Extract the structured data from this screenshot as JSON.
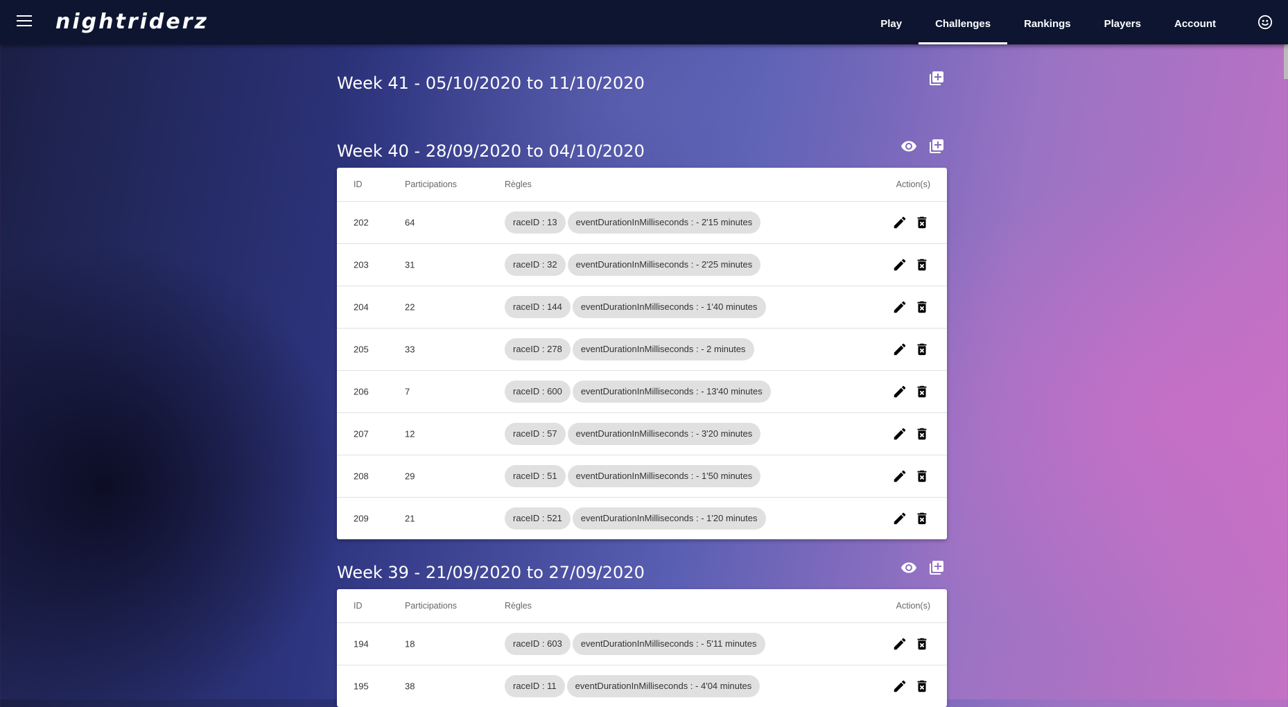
{
  "app": {
    "logo": "nightriderz"
  },
  "nav": {
    "items": [
      "Play",
      "Challenges",
      "Rankings",
      "Players",
      "Account"
    ],
    "active": "Challenges"
  },
  "columns": {
    "id": "ID",
    "participations": "Participations",
    "rules": "Règles",
    "actions": "Action(s)"
  },
  "weeks": [
    {
      "title": "Week 41 - 05/10/2020 to 11/10/2020",
      "has_view_icon": false,
      "rows": []
    },
    {
      "title": "Week 40 - 28/09/2020 to 04/10/2020",
      "has_view_icon": true,
      "rows": [
        {
          "id": "202",
          "participations": "64",
          "race": "raceID : 13",
          "duration": "eventDurationInMilliseconds : - 2'15 minutes"
        },
        {
          "id": "203",
          "participations": "31",
          "race": "raceID : 32",
          "duration": "eventDurationInMilliseconds : - 2'25 minutes"
        },
        {
          "id": "204",
          "participations": "22",
          "race": "raceID : 144",
          "duration": "eventDurationInMilliseconds : - 1'40 minutes"
        },
        {
          "id": "205",
          "participations": "33",
          "race": "raceID : 278",
          "duration": "eventDurationInMilliseconds : - 2 minutes"
        },
        {
          "id": "206",
          "participations": "7",
          "race": "raceID : 600",
          "duration": "eventDurationInMilliseconds : - 13'40 minutes"
        },
        {
          "id": "207",
          "participations": "12",
          "race": "raceID : 57",
          "duration": "eventDurationInMilliseconds : - 3'20 minutes"
        },
        {
          "id": "208",
          "participations": "29",
          "race": "raceID : 51",
          "duration": "eventDurationInMilliseconds : - 1'50 minutes"
        },
        {
          "id": "209",
          "participations": "21",
          "race": "raceID : 521",
          "duration": "eventDurationInMilliseconds : - 1'20 minutes"
        }
      ]
    },
    {
      "title": "Week 39 - 21/09/2020 to 27/09/2020",
      "has_view_icon": true,
      "rows": [
        {
          "id": "194",
          "participations": "18",
          "race": "raceID : 603",
          "duration": "eventDurationInMilliseconds : - 5'11 minutes"
        },
        {
          "id": "195",
          "participations": "38",
          "race": "raceID : 11",
          "duration": "eventDurationInMilliseconds : - 4'04 minutes"
        }
      ]
    }
  ],
  "icons": {
    "menu": "menu-icon",
    "avatar": "avatar-icon",
    "view": "eye-icon",
    "add": "add-box-icon",
    "edit": "pencil-icon",
    "delete": "delete-icon"
  }
}
